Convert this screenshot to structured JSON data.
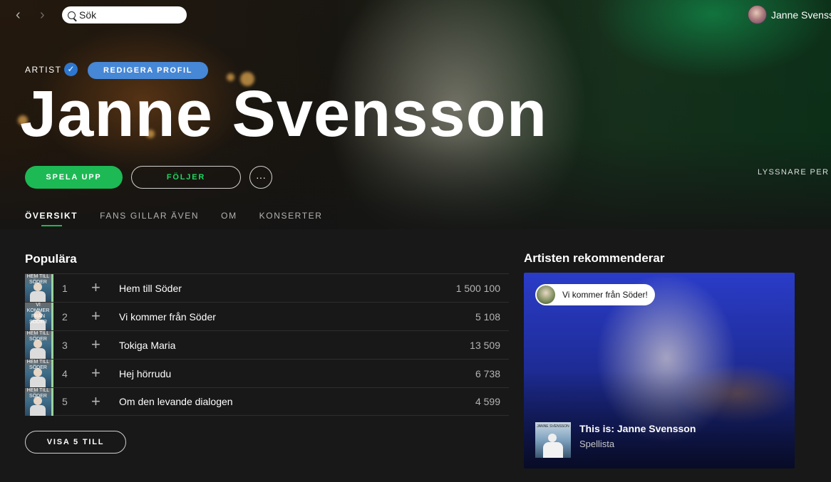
{
  "topbar": {
    "back_icon": "chevron-left-icon",
    "forward_icon": "chevron-right-icon",
    "search_value": "Sök",
    "user_name": "Janne Svensson"
  },
  "hero": {
    "artist_label": "ARTIST",
    "edit_profile_label": "REDIGERA PROFIL",
    "artist_name": "Janne Svensson",
    "play_label": "SPELA UPP",
    "follow_label": "FÖLJER",
    "more_label": "···",
    "listeners_label": "LYSSNARE PER M"
  },
  "tabs": [
    "ÖVERSIKT",
    "FANS GILLAR ÄVEN",
    "OM",
    "KONSERTER"
  ],
  "popular": {
    "title": "Populära",
    "tracks": [
      {
        "num": "1",
        "title": "Hem till Söder",
        "plays": "1 500 100",
        "cover_text": "HEM TILL SÖDER"
      },
      {
        "num": "2",
        "title": "Vi kommer från Söder",
        "plays": "5 108",
        "cover_text": "VI KOMMER FRÅN SÖDER"
      },
      {
        "num": "3",
        "title": "Tokiga Maria",
        "plays": "13 509",
        "cover_text": "HEM TILL SÖDER"
      },
      {
        "num": "4",
        "title": "Hej hörrudu",
        "plays": "6 738",
        "cover_text": "HEM TILL SÖDER"
      },
      {
        "num": "5",
        "title": "Om den levande dialogen",
        "plays": "4 599",
        "cover_text": "HEM TILL SÖDER"
      }
    ],
    "show_more_label": "VISA 5 TILL"
  },
  "recommends": {
    "title": "Artisten rekommenderar",
    "bubble_text": "Vi kommer från Söder!",
    "playlist_title": "This is: Janne Svensson",
    "playlist_type": "Spellista",
    "cover_text": "JANNE SVENSSON"
  },
  "colors": {
    "accent": "#1db954",
    "verified": "#2e77d0",
    "edit_button": "#4687d6",
    "background": "#181818"
  }
}
